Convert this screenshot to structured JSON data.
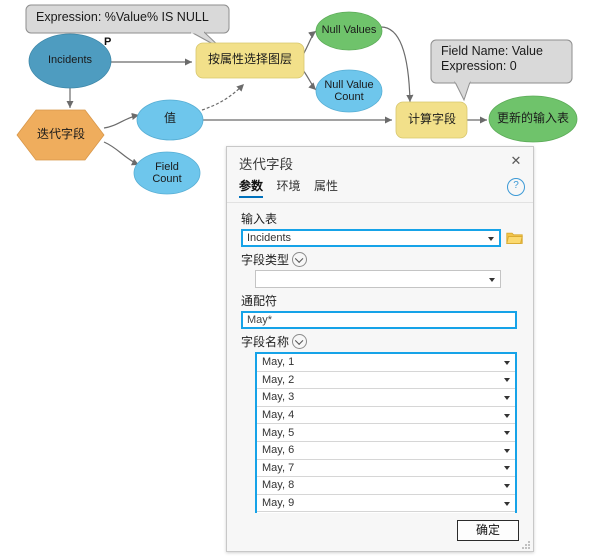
{
  "model": {
    "nodes": [
      {
        "id": "incidents",
        "label": "Incidents",
        "type": "data-input",
        "shape": "ellipse",
        "color": "#4e9cc0",
        "port": "P"
      },
      {
        "id": "select-layer",
        "label": "按属性选择图层",
        "type": "tool",
        "shape": "rounded-rect",
        "color": "#f2e08a"
      },
      {
        "id": "null-values",
        "label": "Null Values",
        "type": "derived-data",
        "shape": "ellipse",
        "color": "#6fc36b"
      },
      {
        "id": "null-value-count",
        "label": "Null Value\nCount",
        "type": "variable",
        "shape": "ellipse",
        "color": "#6ec6ec"
      },
      {
        "id": "iterate-field",
        "label": "迭代字段",
        "type": "iterator",
        "shape": "hexagon",
        "color": "#efad5d"
      },
      {
        "id": "value",
        "label": "值",
        "type": "variable",
        "shape": "ellipse",
        "color": "#6ec6ec"
      },
      {
        "id": "field-count",
        "label": "Field\nCount",
        "type": "variable",
        "shape": "ellipse",
        "color": "#6ec6ec"
      },
      {
        "id": "calculate-field",
        "label": "计算字段",
        "type": "tool",
        "shape": "rounded-rect",
        "color": "#f2e08a"
      },
      {
        "id": "updated-input",
        "label": "更新的输入表",
        "type": "derived-data",
        "shape": "ellipse",
        "color": "#6fc36b"
      }
    ],
    "callouts": [
      {
        "id": "callout-expression",
        "text": "Expression: %Value% IS NULL"
      },
      {
        "id": "callout-field",
        "text": "Field Name: Value\nExpression: 0"
      }
    ]
  },
  "dialog": {
    "title": "迭代字段",
    "close_label": "✕",
    "help_label": "?",
    "tabs": [
      {
        "id": "parameters",
        "label": "参数",
        "active": true
      },
      {
        "id": "environments",
        "label": "环境",
        "active": false
      },
      {
        "id": "properties",
        "label": "属性",
        "active": false
      }
    ],
    "fields": {
      "input_table": {
        "label": "输入表",
        "value": "Incidents",
        "browse_icon": "folder-icon"
      },
      "field_type": {
        "label": "字段类型",
        "value": "",
        "expander_icon": "chevron-down-circle-icon"
      },
      "wildcard": {
        "label": "通配符",
        "value": "May*"
      },
      "field_name": {
        "label": "字段名称",
        "expander_icon": "chevron-down-circle-icon",
        "values": [
          "May, 1",
          "May, 2",
          "May, 3",
          "May, 4",
          "May, 5",
          "May, 6",
          "May, 7",
          "May, 8",
          "May, 9",
          ""
        ]
      }
    },
    "footer": {
      "ok_label": "确定"
    }
  },
  "colors": {
    "accent": "#16a3e8",
    "tab_underline": "#0071bc",
    "tool_yellow": "#f2e08a",
    "data_green": "#6fc36b",
    "variable_blue": "#6ec6ec",
    "input_blue": "#4e9cc0",
    "iterator_orange": "#efad5d",
    "callout_gray": "#d9d9d9"
  }
}
